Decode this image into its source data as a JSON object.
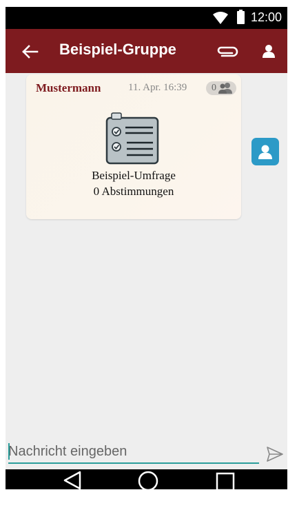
{
  "status_bar": {
    "time": "12:00",
    "wifi_icon": "wifi-icon",
    "battery_icon": "battery-icon"
  },
  "app_bar": {
    "title": "Beispiel-Gruppe",
    "back_icon": "arrow-back-icon",
    "attach_icon": "paperclip-icon",
    "members_icon": "person-icon",
    "background_color": "#7e1b1f"
  },
  "message": {
    "sender": "Mustermann",
    "timestamp": "11. Apr. 16:39",
    "read_count": "0",
    "read_icon": "people-icon",
    "poll": {
      "icon": "clipboard-checklist-icon",
      "title": "Beispiel-Umfrage",
      "votes": "0 Abstimmungen"
    },
    "sender_color": "#7e1b1f"
  },
  "avatar": {
    "icon": "person-icon",
    "color": "#2c9ac7"
  },
  "composer": {
    "placeholder": "Nachricht eingeben",
    "send_icon": "send-icon",
    "accent_color": "#2a9d9a"
  },
  "nav_bar": {
    "back_icon": "nav-back-icon",
    "home_icon": "nav-home-icon",
    "recents_icon": "nav-recents-icon"
  }
}
